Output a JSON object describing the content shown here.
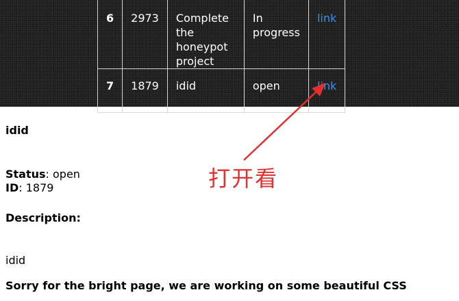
{
  "issues": {
    "rows": [
      {
        "num": "6",
        "id": "2973",
        "title_lines": [
          "Complete the",
          "honeypot",
          "project"
        ],
        "status_lines": [
          "In",
          "progress"
        ],
        "link": "link"
      },
      {
        "num": "7",
        "id": "1879",
        "title_lines": [
          "idid"
        ],
        "status_lines": [
          "open"
        ],
        "link": "link"
      }
    ]
  },
  "detail": {
    "title": "idid",
    "status_label": "Status",
    "status_value": ": open",
    "id_label": "ID",
    "id_value": ": 1879",
    "description_label": "Description:",
    "description_value": "idid",
    "footer_note": "Sorry for the bright page, we are working on some beautiful CSS"
  },
  "annotation": {
    "text": "打开看",
    "color": "#e03030"
  }
}
